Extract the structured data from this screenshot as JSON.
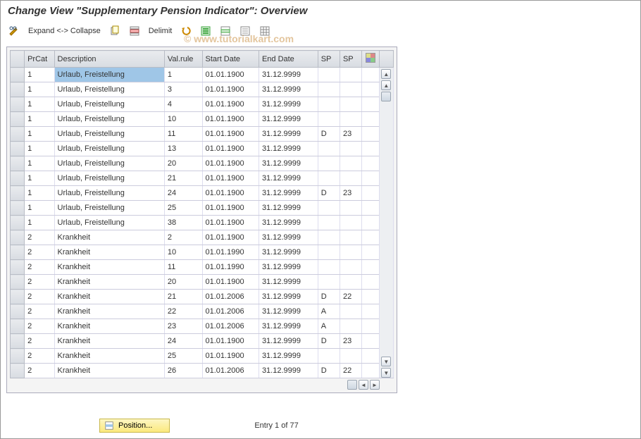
{
  "title": "Change View \"Supplementary Pension Indicator\": Overview",
  "toolbar": {
    "expand_collapse": "Expand <-> Collapse",
    "delimit": "Delimit"
  },
  "watermark": "© www.tutorialkart.com",
  "columns": {
    "prcat": "PrCat",
    "desc": "Description",
    "valrule": "Val.rule",
    "sdate": "Start Date",
    "edate": "End Date",
    "sp1": "SP",
    "sp2": "SP"
  },
  "rows": [
    {
      "prcat": "1",
      "desc": "Urlaub, Freistellung",
      "valrule": "1",
      "sdate": "01.01.1900",
      "edate": "31.12.9999",
      "sp1": "",
      "sp2": ""
    },
    {
      "prcat": "1",
      "desc": "Urlaub, Freistellung",
      "valrule": "3",
      "sdate": "01.01.1900",
      "edate": "31.12.9999",
      "sp1": "",
      "sp2": ""
    },
    {
      "prcat": "1",
      "desc": "Urlaub, Freistellung",
      "valrule": "4",
      "sdate": "01.01.1900",
      "edate": "31.12.9999",
      "sp1": "",
      "sp2": ""
    },
    {
      "prcat": "1",
      "desc": "Urlaub, Freistellung",
      "valrule": "10",
      "sdate": "01.01.1900",
      "edate": "31.12.9999",
      "sp1": "",
      "sp2": ""
    },
    {
      "prcat": "1",
      "desc": "Urlaub, Freistellung",
      "valrule": "11",
      "sdate": "01.01.1900",
      "edate": "31.12.9999",
      "sp1": "D",
      "sp2": "23"
    },
    {
      "prcat": "1",
      "desc": "Urlaub, Freistellung",
      "valrule": "13",
      "sdate": "01.01.1900",
      "edate": "31.12.9999",
      "sp1": "",
      "sp2": ""
    },
    {
      "prcat": "1",
      "desc": "Urlaub, Freistellung",
      "valrule": "20",
      "sdate": "01.01.1900",
      "edate": "31.12.9999",
      "sp1": "",
      "sp2": ""
    },
    {
      "prcat": "1",
      "desc": "Urlaub, Freistellung",
      "valrule": "21",
      "sdate": "01.01.1900",
      "edate": "31.12.9999",
      "sp1": "",
      "sp2": ""
    },
    {
      "prcat": "1",
      "desc": "Urlaub, Freistellung",
      "valrule": "24",
      "sdate": "01.01.1900",
      "edate": "31.12.9999",
      "sp1": "D",
      "sp2": "23"
    },
    {
      "prcat": "1",
      "desc": "Urlaub, Freistellung",
      "valrule": "25",
      "sdate": "01.01.1900",
      "edate": "31.12.9999",
      "sp1": "",
      "sp2": ""
    },
    {
      "prcat": "1",
      "desc": "Urlaub, Freistellung",
      "valrule": "38",
      "sdate": "01.01.1900",
      "edate": "31.12.9999",
      "sp1": "",
      "sp2": ""
    },
    {
      "prcat": "2",
      "desc": "Krankheit",
      "valrule": "2",
      "sdate": "01.01.1900",
      "edate": "31.12.9999",
      "sp1": "",
      "sp2": ""
    },
    {
      "prcat": "2",
      "desc": "Krankheit",
      "valrule": "10",
      "sdate": "01.01.1990",
      "edate": "31.12.9999",
      "sp1": "",
      "sp2": ""
    },
    {
      "prcat": "2",
      "desc": "Krankheit",
      "valrule": "11",
      "sdate": "01.01.1990",
      "edate": "31.12.9999",
      "sp1": "",
      "sp2": ""
    },
    {
      "prcat": "2",
      "desc": "Krankheit",
      "valrule": "20",
      "sdate": "01.01.1900",
      "edate": "31.12.9999",
      "sp1": "",
      "sp2": ""
    },
    {
      "prcat": "2",
      "desc": "Krankheit",
      "valrule": "21",
      "sdate": "01.01.2006",
      "edate": "31.12.9999",
      "sp1": "D",
      "sp2": "22"
    },
    {
      "prcat": "2",
      "desc": "Krankheit",
      "valrule": "22",
      "sdate": "01.01.2006",
      "edate": "31.12.9999",
      "sp1": "A",
      "sp2": ""
    },
    {
      "prcat": "2",
      "desc": "Krankheit",
      "valrule": "23",
      "sdate": "01.01.2006",
      "edate": "31.12.9999",
      "sp1": "A",
      "sp2": ""
    },
    {
      "prcat": "2",
      "desc": "Krankheit",
      "valrule": "24",
      "sdate": "01.01.1900",
      "edate": "31.12.9999",
      "sp1": "D",
      "sp2": "23"
    },
    {
      "prcat": "2",
      "desc": "Krankheit",
      "valrule": "25",
      "sdate": "01.01.1900",
      "edate": "31.12.9999",
      "sp1": "",
      "sp2": ""
    },
    {
      "prcat": "2",
      "desc": "Krankheit",
      "valrule": "26",
      "sdate": "01.01.2006",
      "edate": "31.12.9999",
      "sp1": "D",
      "sp2": "22"
    }
  ],
  "footer": {
    "position_label": "Position...",
    "entry_text": "Entry 1 of 77"
  }
}
